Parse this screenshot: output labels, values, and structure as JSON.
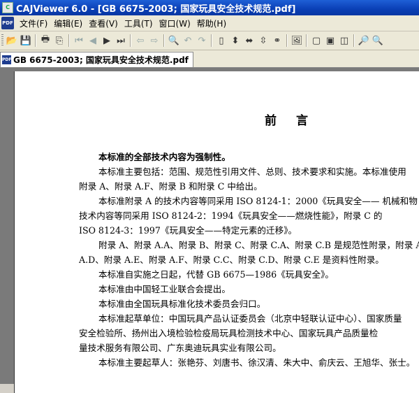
{
  "window": {
    "title": "CAJViewer 6.0 - [GB 6675-2003; 国家玩具安全技术规范.pdf]"
  },
  "menu": {
    "doc_icon": "PDF",
    "items": [
      "文件(F)",
      "编辑(E)",
      "查看(V)",
      "工具(T)",
      "窗口(W)",
      "帮助(H)"
    ]
  },
  "toolbar": {
    "buttons": [
      {
        "name": "open-icon",
        "glyph": "📂",
        "enabled": true
      },
      {
        "name": "save-icon",
        "glyph": "💾",
        "enabled": false
      },
      {
        "name": "print-icon",
        "glyph": "🖶",
        "enabled": true
      },
      {
        "name": "copy-icon",
        "glyph": "⎘",
        "enabled": true
      },
      {
        "name": "first-page-icon",
        "glyph": "⏮",
        "enabled": false
      },
      {
        "name": "prev-page-icon",
        "glyph": "◀",
        "enabled": false
      },
      {
        "name": "next-page-icon",
        "glyph": "▶",
        "enabled": true
      },
      {
        "name": "last-page-icon",
        "glyph": "⏭",
        "enabled": true
      },
      {
        "name": "back-icon",
        "glyph": "⇦",
        "enabled": false
      },
      {
        "name": "forward-icon",
        "glyph": "⇨",
        "enabled": false
      },
      {
        "name": "search-icon",
        "glyph": "🔍",
        "enabled": true
      },
      {
        "name": "undo-icon",
        "glyph": "↶",
        "enabled": false
      },
      {
        "name": "redo-icon",
        "glyph": "↷",
        "enabled": false
      },
      {
        "name": "single-page-icon",
        "glyph": "▯",
        "enabled": true
      },
      {
        "name": "fit-page-icon",
        "glyph": "⬍",
        "enabled": true
      },
      {
        "name": "fit-width-icon",
        "glyph": "⬌",
        "enabled": true
      },
      {
        "name": "actual-size-icon",
        "glyph": "⇳",
        "enabled": true
      },
      {
        "name": "link-icon",
        "glyph": "⚭",
        "enabled": true
      },
      {
        "name": "image-icon",
        "glyph": "🖼",
        "enabled": true
      },
      {
        "name": "page-view-icon",
        "glyph": "▢",
        "enabled": true
      },
      {
        "name": "continuous-view-icon",
        "glyph": "▣",
        "enabled": true
      },
      {
        "name": "facing-view-icon",
        "glyph": "◫",
        "enabled": true
      },
      {
        "name": "zoom-in-icon",
        "glyph": "🔎",
        "enabled": true
      },
      {
        "name": "zoom-out-icon",
        "glyph": "🔍",
        "enabled": true
      }
    ]
  },
  "tab": {
    "icon": "PDF",
    "label": "GB 6675-2003; 国家玩具安全技术规范.pdf"
  },
  "document": {
    "title": "前言",
    "lines": [
      "本标准的全部技术内容为强制性。",
      "本标准主要包括：范围、规范性引用文件、总则、技术要求和实施。本标准使用",
      "附录 A、附录 A.F、附录 B 和附录 C 中给出。",
      "本标准附录 A 的技术内容等同采用 ISO 8124-1：2000《玩具安全—— 机械和物",
      "技术内容等同采用 ISO 8124-2：1994《玩具安全——燃烧性能》，附录 C 的",
      "ISO 8124-3：1997《玩具安全——特定元素的迁移》。",
      "附录 A、附录 A.A、附录 B、附录 C、附录 C.A、附录 C.B 是规范性附录，附录 A",
      "A.D、附录 A.E、附录 A.F、附录 C.C、附录 C.D、附录 C.E 是资料性附录。",
      "本标准自实施之日起，代替 GB 6675—1986《玩具安全》。",
      "本标准由中国轻工业联合会提出。",
      "本标准由全国玩具标准化技术委员会归口。",
      "本标准起草单位：中国玩具产品认证委员会（北京中轻联认证中心）、国家质量",
      "安全检验所、扬州出入境检验检疫局玩具检测技术中心、国家玩具产品质量检",
      "量技术服务有限公司、广东奥迪玩具实业有限公司。",
      "本标准主要起草人：张艳芬、刘唐书、徐汉清、朱大中、俞庆云、王旭华、张士。"
    ]
  }
}
